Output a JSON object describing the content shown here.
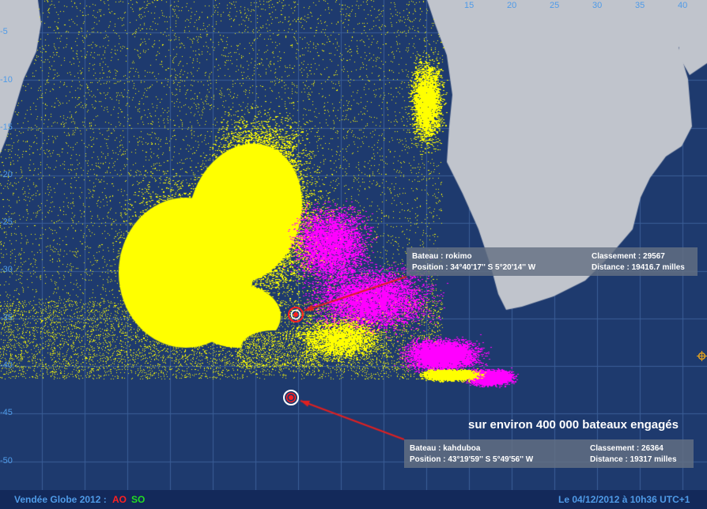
{
  "map": {
    "lon_ticks": [
      "15",
      "20",
      "25",
      "30",
      "35",
      "40"
    ],
    "lat_ticks": [
      "-5",
      "-10",
      "-15",
      "-20",
      "-25",
      "-30",
      "-35",
      "-40",
      "-45",
      "-50"
    ],
    "colors": {
      "ocean": "#1e3a6e",
      "land": "#c0c4cc",
      "grid": "#3a5e98",
      "boats": "#ffff00",
      "leaders": "#ff00ff",
      "marker": "#ff2020",
      "arrow": "#e02020",
      "axis_text": "#4f9be8"
    }
  },
  "boat_rokimo": {
    "name_line": "Bateau : rokimo",
    "position_line": "Position : 34°40'17'' S   5°20'14'' W",
    "rank_line": "Classement : 29567",
    "distance_line": "Distance : 19416.7 milles"
  },
  "boat_kahduboa": {
    "name_line": "Bateau : kahduboa",
    "position_line": "Position : 43°19'59'' S   5°49'56'' W",
    "rank_line": "Classement : 26364",
    "distance_line": "Distance : 19317 milles"
  },
  "headline": "sur environ 400 000 bateaux engagés",
  "footer": {
    "race": "Vendée Globe 2012 :",
    "legend_ao": "AO",
    "legend_so": "SO",
    "legend_ao_color": "#ff2020",
    "legend_so_color": "#22dd22",
    "date": "Le 04/12/2012 à 10h36 UTC+1"
  }
}
